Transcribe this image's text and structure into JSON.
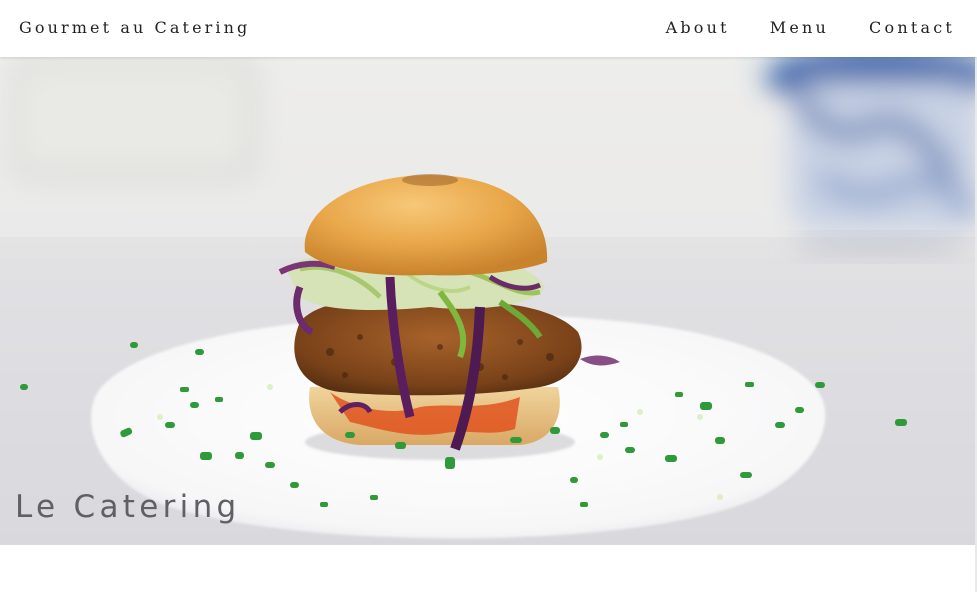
{
  "header": {
    "brand": "Gourmet au Catering",
    "nav": [
      {
        "label": "About"
      },
      {
        "label": "Menu"
      },
      {
        "label": "Contact"
      }
    ]
  },
  "hero": {
    "title": "Le Catering",
    "image_subject": "burger-photo"
  },
  "colors": {
    "header_bg": "#ffffff",
    "text_dark": "#222222",
    "hero_title": "#5f5f66"
  }
}
